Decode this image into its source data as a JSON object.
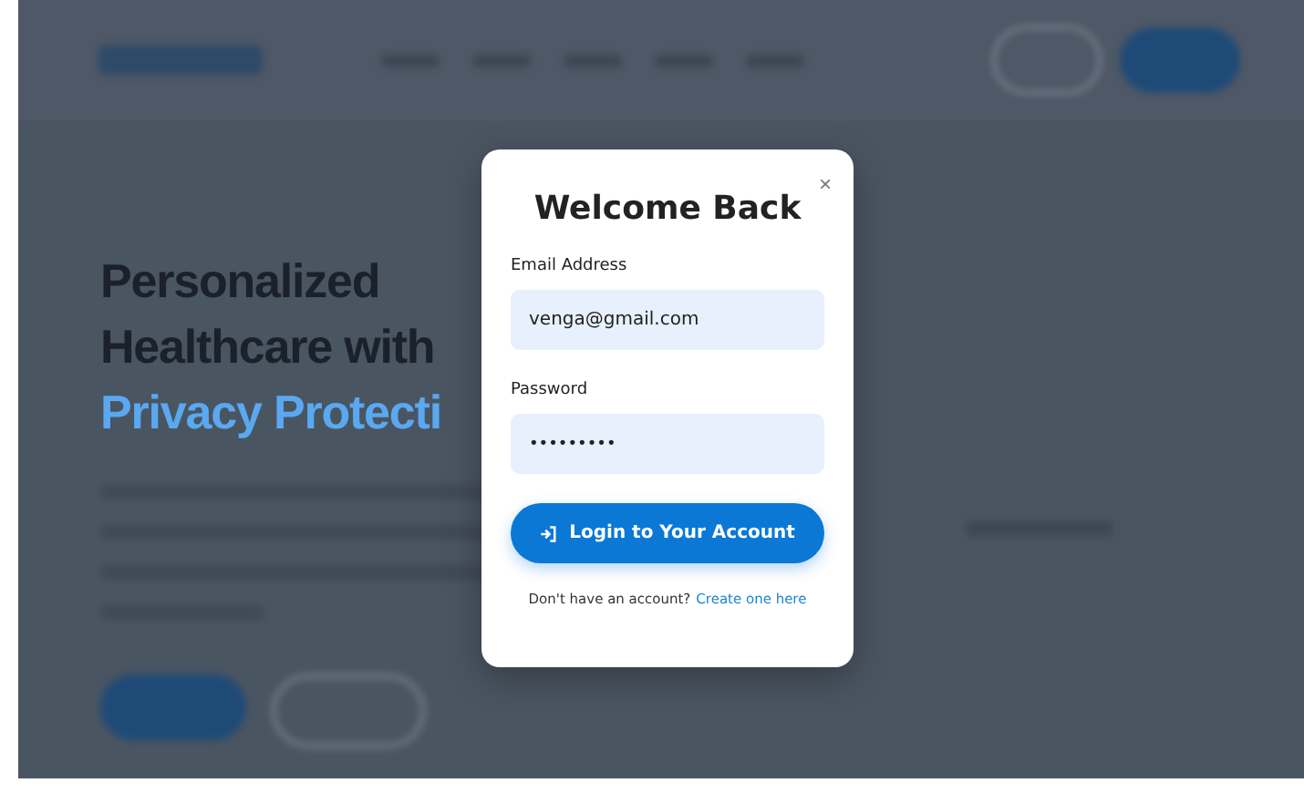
{
  "hero": {
    "title_lines": [
      "Personalized",
      "Healthcare with"
    ],
    "title_accent": "Privacy Protecti"
  },
  "modal": {
    "title": "Welcome Back",
    "close": "×",
    "fields": [
      {
        "label": "Email Address",
        "kind": "text",
        "value": "venga@gmail.com"
      },
      {
        "label": "Password",
        "kind": "password",
        "value": "•••••••••"
      }
    ],
    "submit": "Login to Your Account",
    "footer_text": "Don't have an account?",
    "footer_link": "Create one here"
  }
}
